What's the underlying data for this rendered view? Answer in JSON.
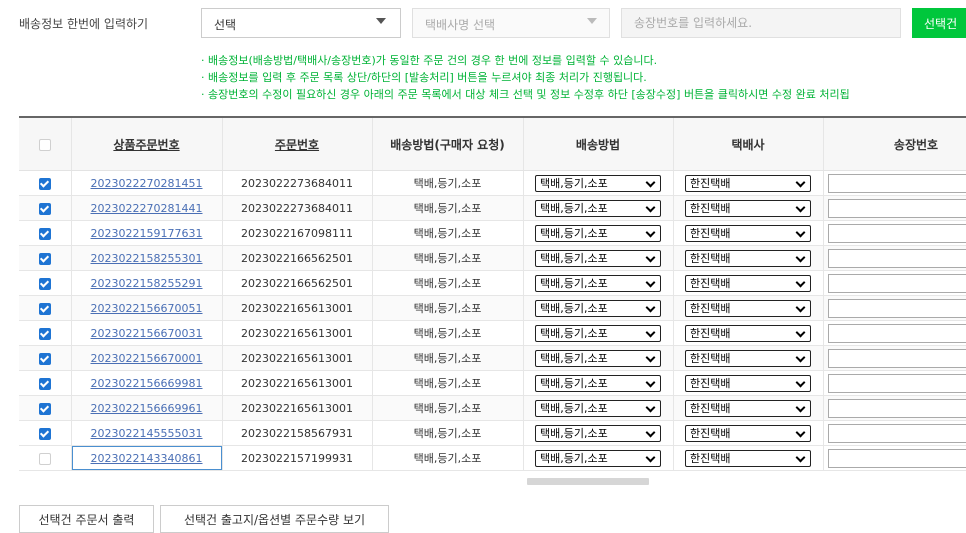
{
  "bulk": {
    "label": "배송정보 한번에 입력하기",
    "method_select": "선택",
    "courier_select_placeholder": "택배사명 선택",
    "invoice_placeholder": "송장번호를 입력하세요.",
    "apply_button": "선택건"
  },
  "notes": [
    "· 배송정보(배송방법/택배사/송장번호)가 동일한 주문 건의 경우 한 번에 정보를 입력할 수 있습니다.",
    "· 배송정보를 입력 후 주문 목록 상단/하단의 [발송처리] 버튼을 누르셔야 최종 처리가 진행됩니다.",
    "· 송장번호의 수정이 필요하신 경우 아래의 주문 목록에서 대상 체크 선택 및 정보 수정후 하단 [송장수정] 버튼을 클릭하시면 수정 완료 처리됩"
  ],
  "colors": {
    "accent_green": "#00c73c",
    "note_green": "#00b336",
    "checkbox_blue": "#1e74d3",
    "link_blue": "#4a6fb5"
  },
  "table": {
    "headers": {
      "product_order_no": "상품주문번호",
      "order_no": "주문번호",
      "buyer_method": "배송방법(구매자 요청)",
      "method": "배송방법",
      "courier": "택배사",
      "invoice": "송장번호"
    },
    "rows": [
      {
        "checked": true,
        "product_order_no": "2023022270281451",
        "order_no": "2023022273684011",
        "buyer_method": "택배,등기,소포",
        "method": "택배,등기,소포",
        "courier": "한진택배"
      },
      {
        "checked": true,
        "product_order_no": "2023022270281441",
        "order_no": "2023022273684011",
        "buyer_method": "택배,등기,소포",
        "method": "택배,등기,소포",
        "courier": "한진택배"
      },
      {
        "checked": true,
        "product_order_no": "2023022159177631",
        "order_no": "2023022167098111",
        "buyer_method": "택배,등기,소포",
        "method": "택배,등기,소포",
        "courier": "한진택배"
      },
      {
        "checked": true,
        "product_order_no": "2023022158255301",
        "order_no": "2023022166562501",
        "buyer_method": "택배,등기,소포",
        "method": "택배,등기,소포",
        "courier": "한진택배"
      },
      {
        "checked": true,
        "product_order_no": "2023022158255291",
        "order_no": "2023022166562501",
        "buyer_method": "택배,등기,소포",
        "method": "택배,등기,소포",
        "courier": "한진택배"
      },
      {
        "checked": true,
        "product_order_no": "2023022156670051",
        "order_no": "2023022165613001",
        "buyer_method": "택배,등기,소포",
        "method": "택배,등기,소포",
        "courier": "한진택배"
      },
      {
        "checked": true,
        "product_order_no": "2023022156670031",
        "order_no": "2023022165613001",
        "buyer_method": "택배,등기,소포",
        "method": "택배,등기,소포",
        "courier": "한진택배"
      },
      {
        "checked": true,
        "product_order_no": "2023022156670001",
        "order_no": "2023022165613001",
        "buyer_method": "택배,등기,소포",
        "method": "택배,등기,소포",
        "courier": "한진택배"
      },
      {
        "checked": true,
        "product_order_no": "2023022156669981",
        "order_no": "2023022165613001",
        "buyer_method": "택배,등기,소포",
        "method": "택배,등기,소포",
        "courier": "한진택배"
      },
      {
        "checked": true,
        "product_order_no": "2023022156669961",
        "order_no": "2023022165613001",
        "buyer_method": "택배,등기,소포",
        "method": "택배,등기,소포",
        "courier": "한진택배"
      },
      {
        "checked": true,
        "product_order_no": "2023022145555031",
        "order_no": "2023022158567931",
        "buyer_method": "택배,등기,소포",
        "method": "택배,등기,소포",
        "courier": "한진택배"
      },
      {
        "checked": false,
        "product_order_no": "2023022143340861",
        "order_no": "2023022157199931",
        "buyer_method": "택배,등기,소포",
        "method": "택배,등기,소포",
        "courier": "한진택배"
      }
    ]
  },
  "buttons": {
    "print_orders": "선택건 주문서 출력",
    "view_quantity": "선택건 출고지/옵션별 주문수량 보기"
  }
}
